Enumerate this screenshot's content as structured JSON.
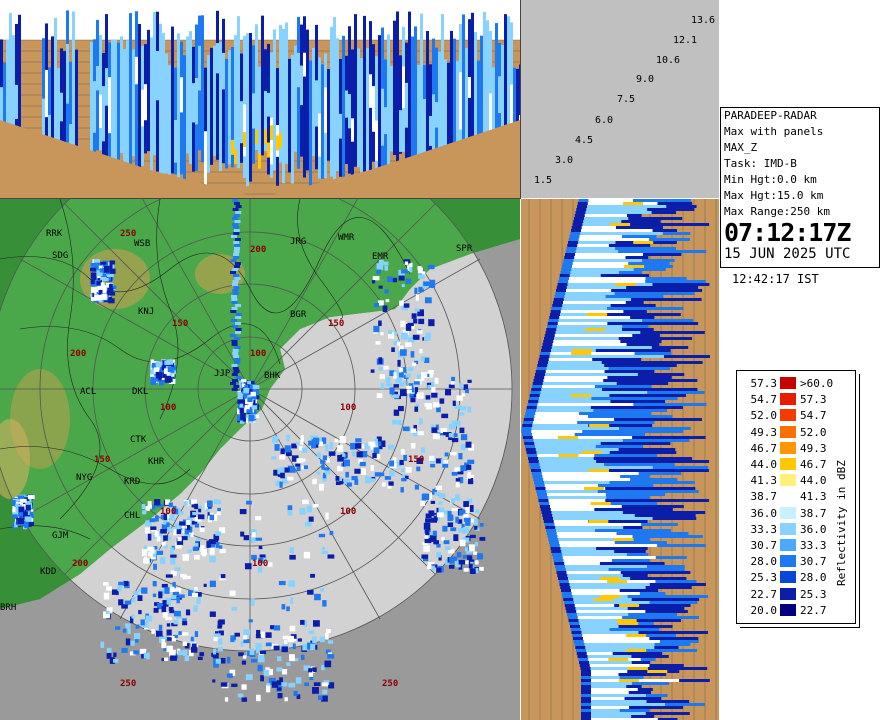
{
  "station": {
    "lines": [
      "PARADEEP-RADAR",
      "Max with panels",
      "MAX_Z",
      "Task: IMD-B",
      "Min Hgt:0.0 km",
      "Max Hgt:15.0 km",
      "Max Range:250 km"
    ],
    "time_utc": "07:12:17Z",
    "date_utc": "15 JUN 2025 UTC",
    "time_ist": "12:42:17 IST"
  },
  "elevation_angles": [
    "13.6",
    "12.1",
    "10.6",
    "9.0",
    "7.5",
    "6.0",
    "4.5",
    "3.0",
    "1.5"
  ],
  "legend": {
    "title": "Reflectivity in dBZ",
    "entries": [
      {
        "lo": "57.3",
        "hi": ">60.0",
        "color": "#c80000"
      },
      {
        "lo": "54.7",
        "hi": "57.3",
        "color": "#e61e00"
      },
      {
        "lo": "52.0",
        "hi": "54.7",
        "color": "#f53c00"
      },
      {
        "lo": "49.3",
        "hi": "52.0",
        "color": "#ff6e00"
      },
      {
        "lo": "46.7",
        "hi": "49.3",
        "color": "#ff9600"
      },
      {
        "lo": "44.0",
        "hi": "46.7",
        "color": "#ffc800"
      },
      {
        "lo": "41.3",
        "hi": "44.0",
        "color": "#fff07a"
      },
      {
        "lo": "38.7",
        "hi": "41.3",
        "color": "#ffffff"
      },
      {
        "lo": "36.0",
        "hi": "38.7",
        "color": "#c8f0ff"
      },
      {
        "lo": "33.3",
        "hi": "36.0",
        "color": "#87d2ff"
      },
      {
        "lo": "30.7",
        "hi": "33.3",
        "color": "#4baaff"
      },
      {
        "lo": "28.0",
        "hi": "30.7",
        "color": "#1e78f0"
      },
      {
        "lo": "25.3",
        "hi": "28.0",
        "color": "#0a46dc"
      },
      {
        "lo": "22.7",
        "hi": "25.3",
        "color": "#0a1eaa"
      },
      {
        "lo": "20.0",
        "hi": "22.7",
        "color": "#000080"
      }
    ]
  },
  "map": {
    "place_labels": [
      "RRK",
      "SDG",
      "WSB",
      "JRG",
      "WMR",
      "EMR",
      "SPR",
      "KNJ",
      "BGR",
      "DKL",
      "JJP",
      "ACL",
      "CTK",
      "BHK",
      "KHR",
      "NYG",
      "KRD",
      "CHL",
      "GJM",
      "KDD",
      "BRH"
    ],
    "range_labels": [
      "250",
      "200",
      "150",
      "100"
    ],
    "colors": {
      "land": "#3c9a3c",
      "sea": "#d2d2d2",
      "outside": "#9a9a9a",
      "hill": "#c8a050"
    }
  },
  "cross_section": {
    "background": "#c8965a",
    "echo_colors": [
      "#0a1eaa",
      "#1e78f0",
      "#87d2ff",
      "#ffffff",
      "#ffc800"
    ]
  }
}
